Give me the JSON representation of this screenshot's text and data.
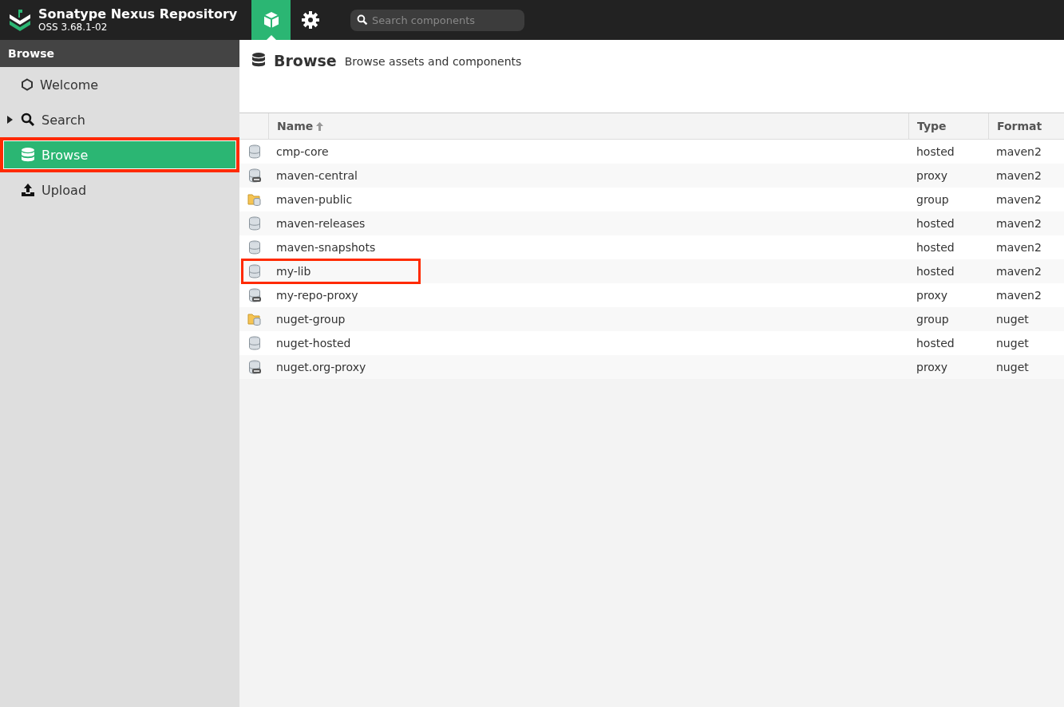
{
  "header": {
    "title": "Sonatype Nexus Repository",
    "version": "OSS 3.68.1-02",
    "nav": [
      {
        "kind": "browse",
        "selected": true
      },
      {
        "kind": "admin",
        "selected": false
      }
    ],
    "search": {
      "placeholder": "Search components"
    }
  },
  "sidebar": {
    "title": "Browse",
    "items": [
      {
        "label": "Welcome",
        "kind": "welcome",
        "selected": false,
        "highlighted": false
      },
      {
        "label": "Search",
        "kind": "search",
        "selected": false,
        "highlighted": false,
        "expanded": false
      },
      {
        "label": "Browse",
        "kind": "browse",
        "selected": true,
        "highlighted": true
      },
      {
        "label": "Upload",
        "kind": "upload",
        "selected": false,
        "highlighted": false
      }
    ]
  },
  "page": {
    "title": "Browse",
    "subtitle": "Browse assets and components"
  },
  "table": {
    "columns": [
      {
        "label": "Name",
        "sorted": true
      },
      {
        "label": "Type",
        "sorted": false
      },
      {
        "label": "Format",
        "sorted": false
      }
    ],
    "rows": [
      {
        "name": "cmp-core",
        "type": "hosted",
        "format": "maven2",
        "kind": "hosted",
        "highlighted": false
      },
      {
        "name": "maven-central",
        "type": "proxy",
        "format": "maven2",
        "kind": "proxy",
        "highlighted": false
      },
      {
        "name": "maven-public",
        "type": "group",
        "format": "maven2",
        "kind": "group",
        "highlighted": false
      },
      {
        "name": "maven-releases",
        "type": "hosted",
        "format": "maven2",
        "kind": "hosted",
        "highlighted": false
      },
      {
        "name": "maven-snapshots",
        "type": "hosted",
        "format": "maven2",
        "kind": "hosted",
        "highlighted": false
      },
      {
        "name": "my-lib",
        "type": "hosted",
        "format": "maven2",
        "kind": "hosted",
        "highlighted": true
      },
      {
        "name": "my-repo-proxy",
        "type": "proxy",
        "format": "maven2",
        "kind": "proxy",
        "highlighted": false
      },
      {
        "name": "nuget-group",
        "type": "group",
        "format": "nuget",
        "kind": "group",
        "highlighted": false
      },
      {
        "name": "nuget-hosted",
        "type": "hosted",
        "format": "nuget",
        "kind": "hosted",
        "highlighted": false
      },
      {
        "name": "nuget.org-proxy",
        "type": "proxy",
        "format": "nuget",
        "kind": "proxy",
        "highlighted": false
      }
    ]
  }
}
